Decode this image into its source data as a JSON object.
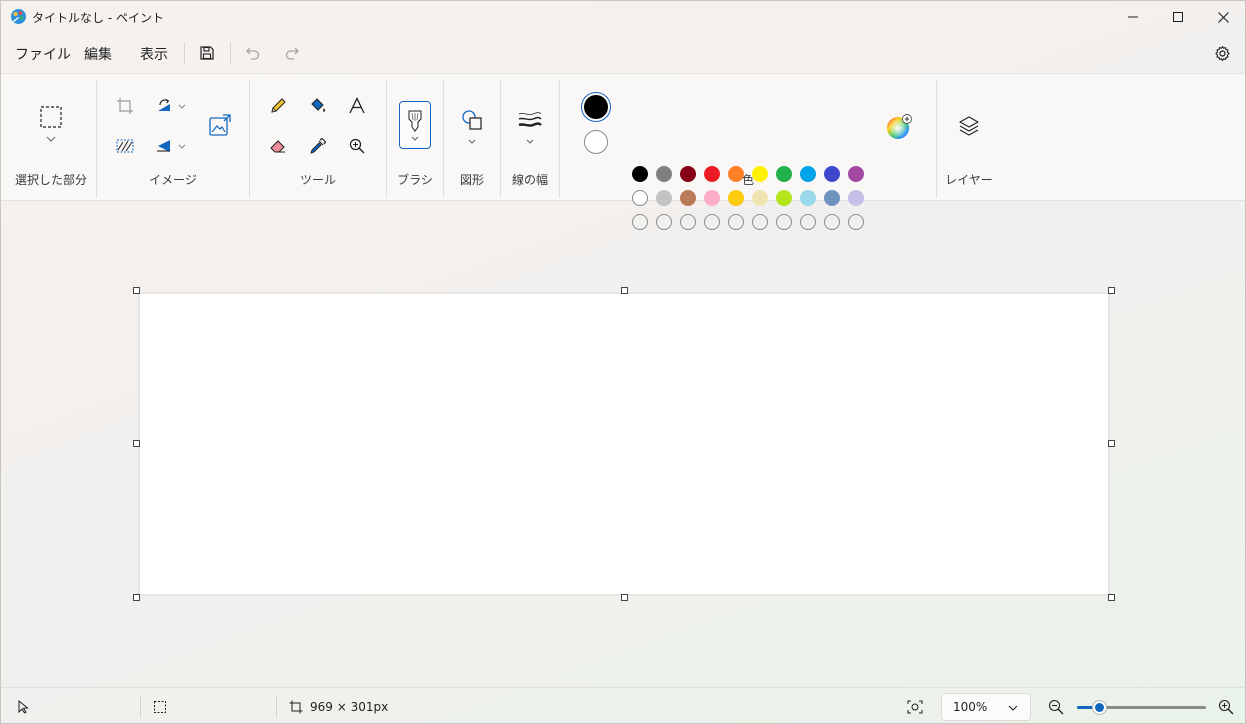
{
  "window": {
    "title": "タイトルなし - ペイント"
  },
  "menu": {
    "file": "ファイル",
    "edit": "編集",
    "view": "表示"
  },
  "ribbon": {
    "groups": {
      "selection": "選択した部分",
      "image": "イメージ",
      "tools": "ツール",
      "brush": "ブラシ",
      "shapes": "図形",
      "stroke_width": "線の幅",
      "colors": "色",
      "layers": "レイヤー"
    },
    "primary_color": "#000000",
    "secondary_color": "#ffffff",
    "palette_row1": [
      "#000000",
      "#7f7f7f",
      "#880015",
      "#ed1c24",
      "#ff7f27",
      "#fff200",
      "#22b14c",
      "#00a2e8",
      "#3f48cc",
      "#a349a4"
    ],
    "palette_row2": [
      "#ffffff",
      "#c3c3c3",
      "#b97a57",
      "#ffaec9",
      "#ffc90e",
      "#efe4b0",
      "#b5e61d",
      "#99d9ea",
      "#7092be",
      "#c8bfe7"
    ]
  },
  "status": {
    "canvas_size": "969 × 301px",
    "zoom_value": "100%",
    "zoom_fraction": 0.17
  }
}
